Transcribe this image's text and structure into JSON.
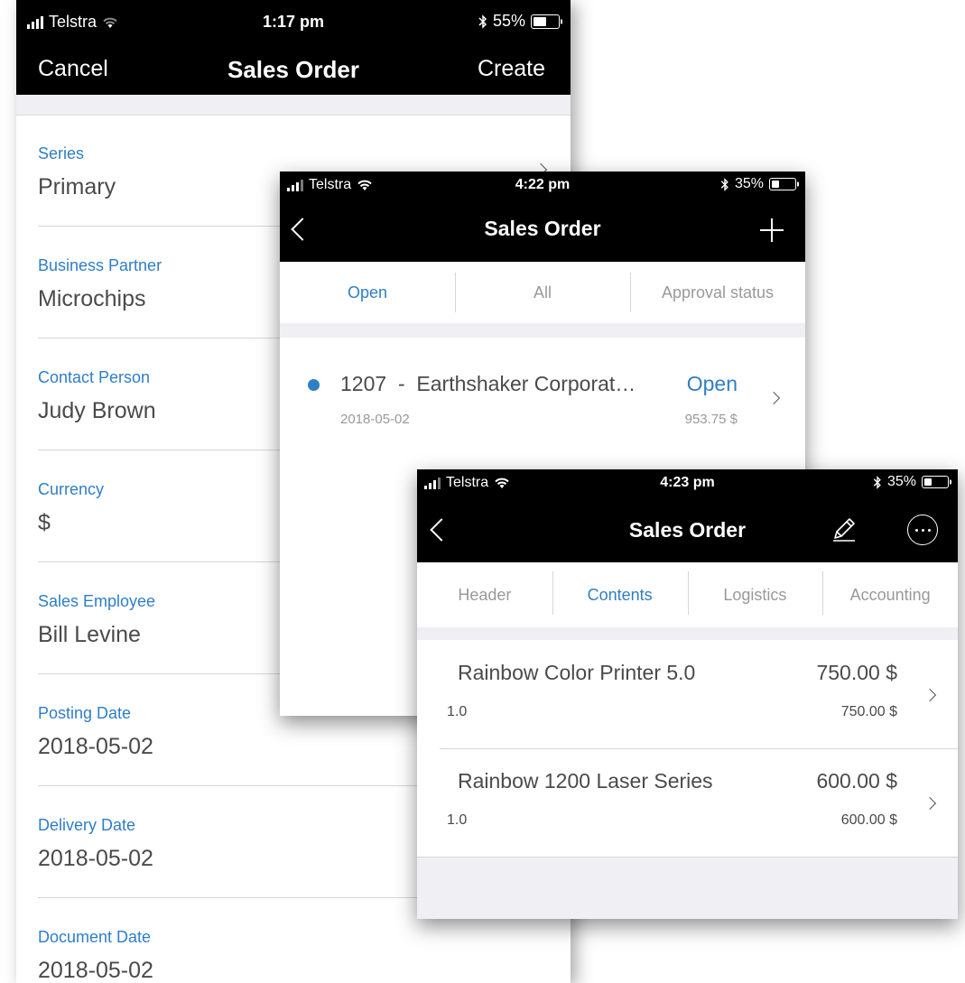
{
  "screen1": {
    "status": {
      "carrier": "Telstra",
      "time": "1:17 pm",
      "battery": "55%",
      "battery_level": 0.55
    },
    "nav": {
      "cancel": "Cancel",
      "title": "Sales Order",
      "create": "Create"
    },
    "fields": [
      {
        "label": "Series",
        "value": "Primary"
      },
      {
        "label": "Business Partner",
        "value": "Microchips"
      },
      {
        "label": "Contact Person",
        "value": "Judy Brown"
      },
      {
        "label": "Currency",
        "value": "$"
      },
      {
        "label": "Sales Employee",
        "value": "Bill Levine"
      },
      {
        "label": "Posting Date",
        "value": "2018-05-02"
      },
      {
        "label": "Delivery Date",
        "value": "2018-05-02"
      },
      {
        "label": "Document Date",
        "value": "2018-05-02"
      }
    ]
  },
  "screen2": {
    "status": {
      "carrier": "Telstra",
      "time": "4:22 pm",
      "battery": "35%",
      "battery_level": 0.35
    },
    "nav": {
      "title": "Sales Order"
    },
    "tabs": [
      {
        "label": "Open"
      },
      {
        "label": "All"
      },
      {
        "label": "Approval status"
      }
    ],
    "order": {
      "number": "1207",
      "separator": "-",
      "customer": "Earthshaker Corporat…",
      "status": "Open",
      "date": "2018-05-02",
      "amount": "953.75 $"
    }
  },
  "screen3": {
    "status": {
      "carrier": "Telstra",
      "time": "4:23 pm",
      "battery": "35%",
      "battery_level": 0.35
    },
    "nav": {
      "title": "Sales Order"
    },
    "tabs": [
      {
        "label": "Header"
      },
      {
        "label": "Contents"
      },
      {
        "label": "Logistics"
      },
      {
        "label": "Accounting"
      }
    ],
    "items": [
      {
        "name": "Rainbow Color Printer 5.0",
        "price": "750.00 $",
        "qty": "1.0",
        "total": "750.00 $"
      },
      {
        "name": "Rainbow 1200 Laser Series",
        "price": "600.00 $",
        "qty": "1.0",
        "total": "600.00 $"
      }
    ]
  },
  "colors": {
    "accent": "#2f7ec7",
    "bar": "#000000",
    "label_gray": "#999999",
    "text": "#4a4a4a"
  },
  "icons": [
    "signal-icon",
    "wifi-icon",
    "bluetooth-icon",
    "battery-icon",
    "back-chevron-icon",
    "plus-icon",
    "pencil-icon",
    "more-icon",
    "chevron-right-icon",
    "status-dot-icon"
  ]
}
